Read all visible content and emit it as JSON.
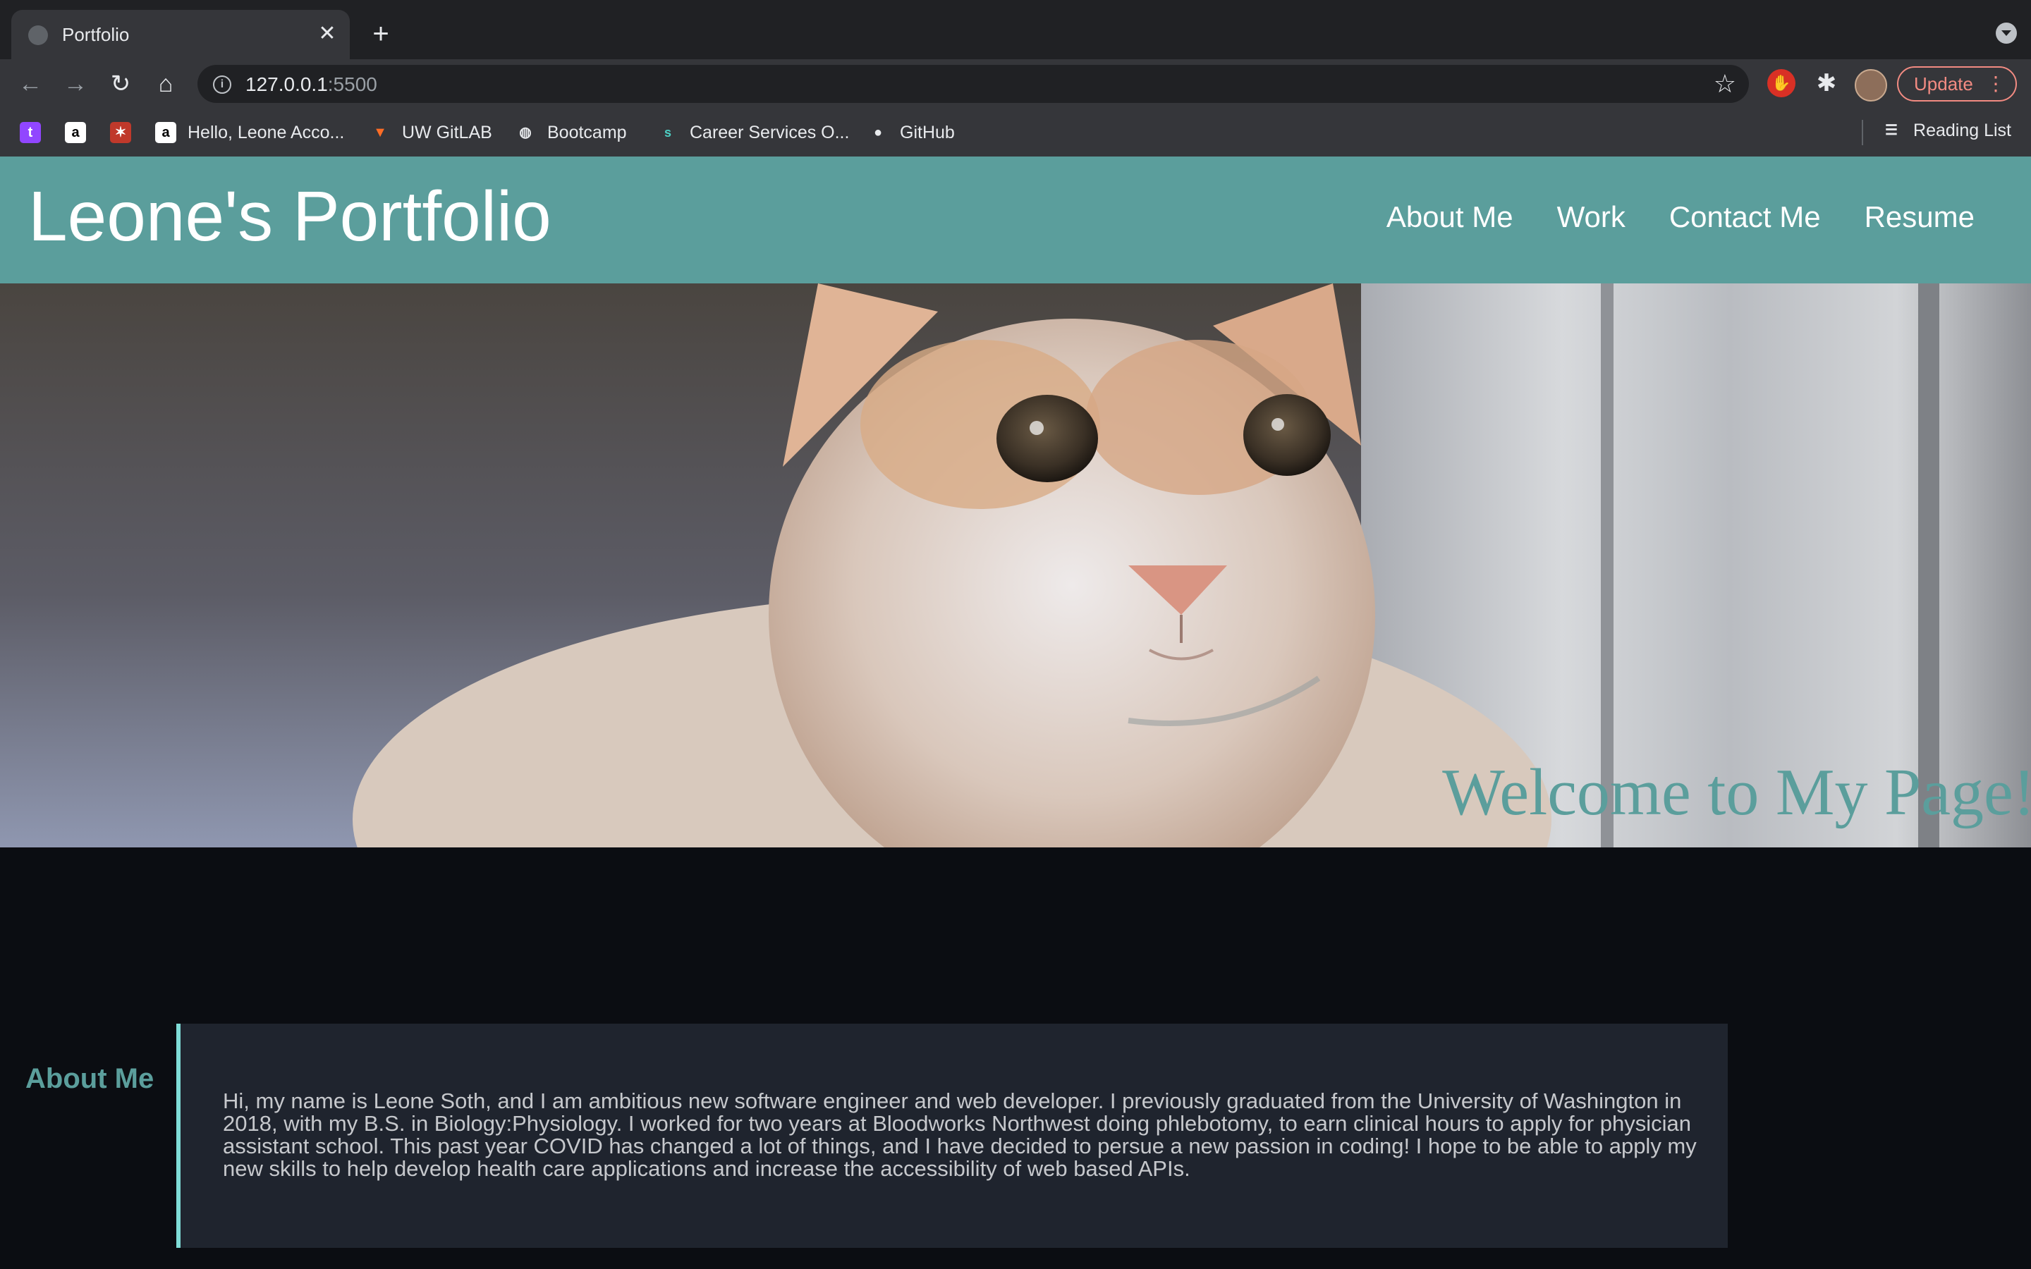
{
  "browser": {
    "tab_title": "Portfolio",
    "url_host": "127.0.0.1",
    "url_port": ":5500",
    "update_label": "Update",
    "bookmarks": [
      {
        "label": ""
      },
      {
        "label": ""
      },
      {
        "label": ""
      },
      {
        "label": "Hello, Leone Acco..."
      },
      {
        "label": "UW GitLAB"
      },
      {
        "label": "Bootcamp"
      },
      {
        "label": "Career Services O..."
      },
      {
        "label": "GitHub"
      }
    ],
    "reading_list_label": "Reading List"
  },
  "site": {
    "title": "Leone's Portfolio",
    "nav": [
      "About Me",
      "Work",
      "Contact Me",
      "Resume"
    ],
    "hero_text": "Welcome to My Page!",
    "about": {
      "heading": "About Me",
      "body": "Hi, my name is Leone Soth, and I am ambitious new software engineer and web developer. I previously graduated from the University of Washington in 2018, with my B.S. in Biology:Physiology. I worked for two years at Bloodworks Northwest doing phlebotomy, to earn clinical hours to apply for physician assistant school. This past year COVID has changed a lot of things, and I have decided to persue a new passion in coding! I hope to be able to apply my new skills to help develop health care applications and increase the accessibility of web based APIs."
    }
  },
  "colors": {
    "accent": "#5b9e9c",
    "page_bg": "#0b0d12",
    "card_bg": "#1f242e",
    "card_border": "#7fdcd7"
  }
}
